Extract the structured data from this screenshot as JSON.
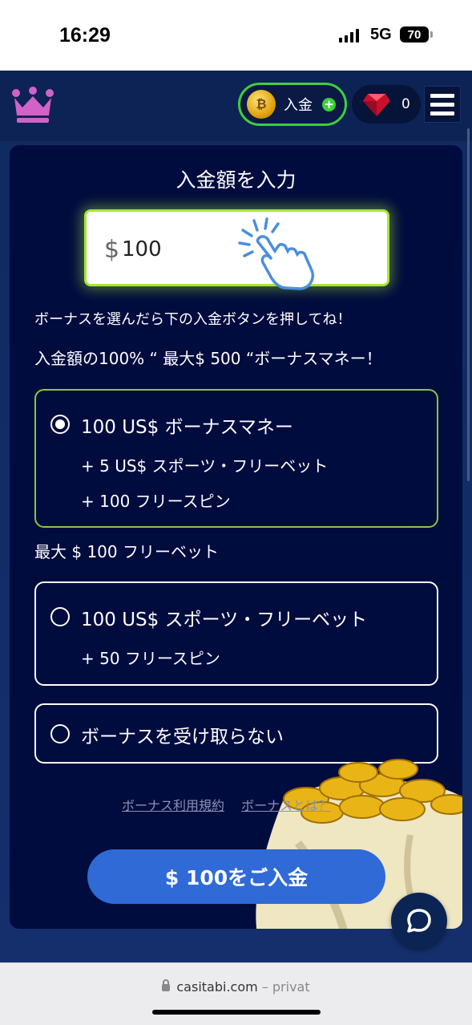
{
  "status_bar": {
    "time": "16:29",
    "network": "5G",
    "battery": "70"
  },
  "header": {
    "logo_icon": "crown-icon",
    "deposit_label": "入金",
    "gem_count": "0",
    "colors": {
      "deposit_border": "#3ecf3a",
      "crown": "#d163c8"
    }
  },
  "form": {
    "title": "入金額を入力",
    "currency_symbol": "$",
    "amount": "100",
    "hint": "ボーナスを選んだら下の入金ボタンを押してね！",
    "promo": "入金額の100% “ 最大$ 500 “ボーナスマネー！"
  },
  "options": [
    {
      "label": "100 US$ ボーナスマネー",
      "sub": [
        "+ 5 US$  スポーツ・フリーベット",
        "+ 100  フリースピン"
      ],
      "selected": true
    },
    {
      "label": "100 US$ スポーツ・フリーベット",
      "sub": [
        "+ 50  フリースピン"
      ],
      "selected": false
    },
    {
      "label": "ボーナスを受け取らない",
      "sub": [],
      "selected": false
    }
  ],
  "max_freebet": "最大 $ 100 フリーベット",
  "links": {
    "terms": "ボーナス利用規約",
    "about": "ボーナスとは？"
  },
  "submit_label": "$ 100をご入金",
  "browser": {
    "domain": "casitabi.com",
    "suffix": "– privat"
  },
  "accent": {
    "submit": "#2f6ad6",
    "selected_border": "#8cc63e",
    "card_bg": "#000b3e"
  }
}
